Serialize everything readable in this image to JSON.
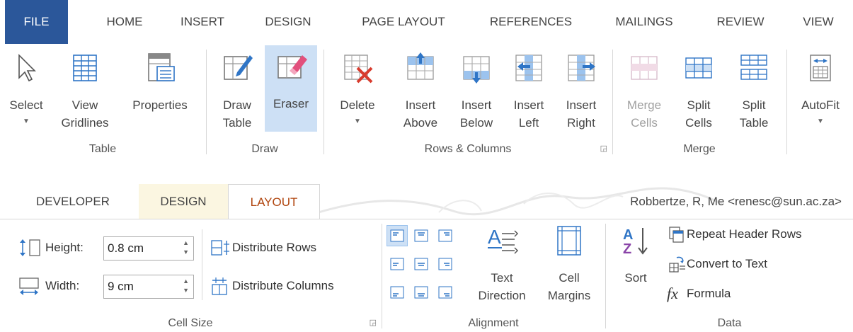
{
  "tabs": [
    {
      "label": "FILE"
    },
    {
      "label": "HOME"
    },
    {
      "label": "INSERT"
    },
    {
      "label": "DESIGN"
    },
    {
      "label": "PAGE LAYOUT"
    },
    {
      "label": "REFERENCES"
    },
    {
      "label": "MAILINGS"
    },
    {
      "label": "REVIEW"
    },
    {
      "label": "VIEW"
    }
  ],
  "ribbon": {
    "table_group": {
      "label": "Table",
      "select": "Select",
      "view_gridlines_1": "View",
      "view_gridlines_2": "Gridlines",
      "properties": "Properties"
    },
    "draw_group": {
      "label": "Draw",
      "draw_table_1": "Draw",
      "draw_table_2": "Table",
      "eraser": "Eraser"
    },
    "rows_group": {
      "label": "Rows & Columns",
      "delete": "Delete",
      "insert_above_1": "Insert",
      "insert_above_2": "Above",
      "insert_below_1": "Insert",
      "insert_below_2": "Below",
      "insert_left_1": "Insert",
      "insert_left_2": "Left",
      "insert_right_1": "Insert",
      "insert_right_2": "Right"
    },
    "merge_group": {
      "label": "Merge",
      "merge_cells_1": "Merge",
      "merge_cells_2": "Cells",
      "split_cells_1": "Split",
      "split_cells_2": "Cells",
      "split_table_1": "Split",
      "split_table_2": "Table"
    },
    "autofit": "AutoFit"
  },
  "tabs2": [
    {
      "label": "DEVELOPER"
    },
    {
      "label": "DESIGN"
    },
    {
      "label": "LAYOUT"
    }
  ],
  "account": "Robbertze, R, Me <renesc@sun.ac.za>",
  "ribbon2": {
    "cell_size": {
      "label": "Cell Size",
      "height_label": "Height:",
      "height_value": "0.8 cm",
      "width_label": "Width:",
      "width_value": "9 cm",
      "distribute_rows": "Distribute Rows",
      "distribute_columns": "Distribute Columns"
    },
    "alignment": {
      "label": "Alignment",
      "text_direction_1": "Text",
      "text_direction_2": "Direction",
      "cell_margins_1": "Cell",
      "cell_margins_2": "Margins"
    },
    "data": {
      "label": "Data",
      "sort": "Sort",
      "repeat_header_rows": "Repeat Header Rows",
      "convert_to_text": "Convert to Text",
      "formula": "Formula"
    }
  },
  "colors": {
    "file_tab": "#2b579a",
    "layout_tab_text": "#b0450e",
    "active_button": "#cde0f5",
    "design_tab": "#fbf6e1",
    "accent_blue": "#2f75c6",
    "eraser_pink": "#e2507c",
    "delete_red": "#d83b2d"
  }
}
